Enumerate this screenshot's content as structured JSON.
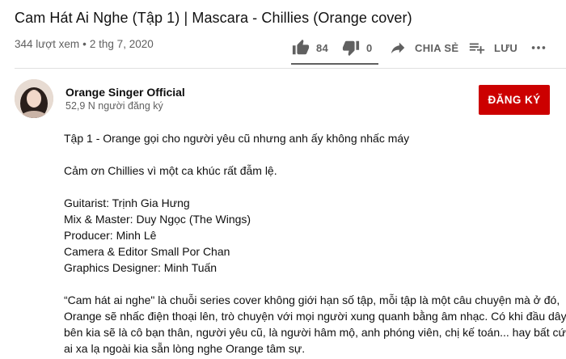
{
  "video": {
    "title": "Cam Hát Ai Nghe (Tập 1) | Mascara - Chillies (Orange cover)",
    "views": "344 lượt xem",
    "separator": "•",
    "date": "2 thg 7, 2020"
  },
  "actions": {
    "likes": "84",
    "dislikes": "0",
    "share_label": "CHIA SẺ",
    "save_label": "LƯU",
    "like_ratio": 1.0
  },
  "channel": {
    "name": "Orange Singer Official",
    "subscribers": "52,9 N người đăng ký",
    "subscribe_label": "ĐĂNG KÝ"
  },
  "description": {
    "line1": "Tập 1 - Orange gọi cho người yêu cũ nhưng anh ấy không nhấc máy",
    "line2": "Cảm ơn Chillies vì một ca khúc rất đẫm lệ.",
    "credits": [
      "Guitarist: Trịnh Gia Hưng",
      "Mix & Master: Duy Ngọc (The Wings)",
      "Producer: Minh Lê",
      "Camera & Editor Small Por Chan",
      "Graphics Designer: Minh Tuấn"
    ],
    "para1": "“Cam hát ai nghe\" là chuỗi series cover không giới hạn số tập, mỗi tập là một câu chuyện mà ở đó,",
    "para2": "Orange sẽ nhấc điện thoại lên, trò chuyện với mọi người xung quanh bằng âm nhạc. Có khi đầu dây",
    "para3": "bên kia sẽ là cô bạn thân, người yêu cũ, là người hâm mộ, anh phóng viên, chị kế toán... hay bất cứ",
    "para4": "ai xa lạ ngoài kia sẵn lòng nghe Orange tâm sự."
  },
  "icons": {
    "like": "thumbs-up-icon",
    "dislike": "thumbs-down-icon",
    "share": "share-arrow-icon",
    "save": "playlist-add-icon",
    "more": "more-horizontal-icon"
  },
  "colors": {
    "subscribe": "#cc0000",
    "secondary_text": "#606060"
  }
}
